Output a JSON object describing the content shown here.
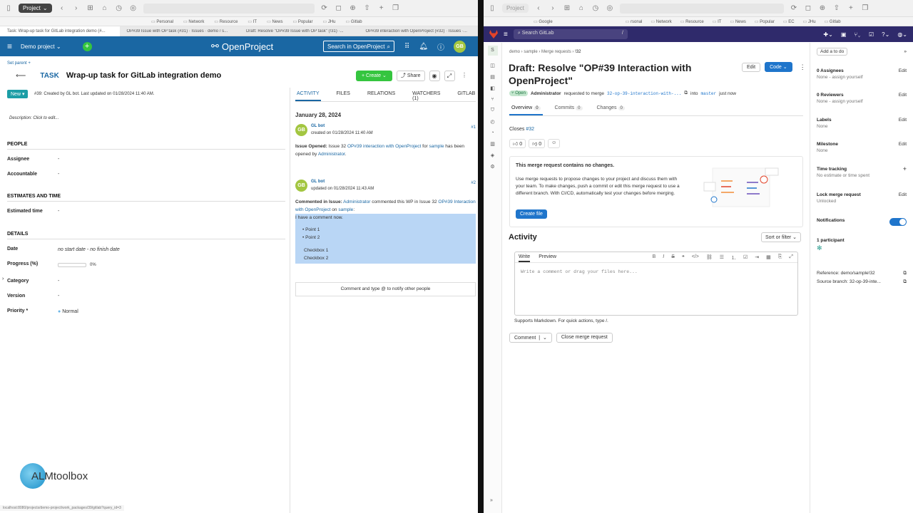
{
  "left": {
    "chrome": {
      "project_chip": "Project"
    },
    "bookmarks": [
      "Personal",
      "Network",
      "Resource",
      "IT",
      "News",
      "Popular",
      "JHu",
      "Gitlab"
    ],
    "tabs": [
      "Task: Wrap-up task for GitLab integration demo (#...",
      "OP#39 Issue with OP task (#31) · Issues · demo / s...",
      "Draft: Resolve \"OP#39 Issue with OP task\" (!31) ·...",
      "OP#39 interaction with OpenProject (#32) · Issues ·..."
    ],
    "header": {
      "project": "Demo project",
      "logo": "OpenProject",
      "search": "Search in OpenProject",
      "avatar": "GB"
    },
    "wp": {
      "set_parent": "Set parent +",
      "type": "TASK",
      "title": "Wrap-up task for GitLab integration demo",
      "create": "+ Create",
      "share": "Share",
      "status": "New",
      "created": "#39: Created by GL bot. Last updated on 01/28/2024 11:40 AM.",
      "description": "Description: Click to edit..."
    },
    "sections": {
      "people": "PEOPLE",
      "estimates": "ESTIMATES AND TIME",
      "details": "DETAILS"
    },
    "attrs": {
      "assignee": {
        "label": "Assignee",
        "value": "-"
      },
      "accountable": {
        "label": "Accountable",
        "value": "-"
      },
      "estimated": {
        "label": "Estimated time",
        "value": "-"
      },
      "date": {
        "label": "Date",
        "value": "no start date - no finish date"
      },
      "progress": {
        "label": "Progress (%)",
        "value": "0%"
      },
      "category": {
        "label": "Category",
        "value": "-"
      },
      "version": {
        "label": "Version",
        "value": "-"
      },
      "priority": {
        "label": "Priority *",
        "value": "Normal"
      }
    },
    "activity_tabs": [
      "ACTIVITY",
      "FILES",
      "RELATIONS",
      "WATCHERS (1)",
      "GITLAB"
    ],
    "activity": {
      "date": "January 28, 2024",
      "e1": {
        "name": "GL bot",
        "meta": "created on 01/28/2024 11:40 AM",
        "num": "#1",
        "b1": "Issue Opened:",
        "b2": " Issue 32 ",
        "b3": "OP#39 interaction with OpenProject",
        "b4": " for ",
        "b5": "sample",
        "b6": " has been opened by ",
        "b7": "Administrator",
        "b8": "."
      },
      "e2": {
        "name": "GL bot",
        "meta": "updated on 01/28/2024 11:43 AM",
        "num": "#2",
        "b1": "Commented in Issue:",
        "b2": " Administrator",
        "b3": " commented this WP in Issue 32 ",
        "b4": "OP#39 Interaction with OpenProject",
        "b5": " on ",
        "b6": "sample",
        "b7": ":",
        "q": "I have a comment now.",
        "p1": "Point 1",
        "p2": "Point 2",
        "c1": "Checkbox 1",
        "c2": "Checkbox 2"
      },
      "comment_placeholder": "Comment and type @ to notify other people"
    },
    "alm": "ALMtoolbox",
    "statusbar": "localhost:8080/projects/demo-project/work_packages/39/gitlab?query_id=3"
  },
  "right": {
    "chrome": {
      "project_chip": "Project"
    },
    "bookmarks": [
      "Google",
      "rsonal",
      "Network",
      "Resource",
      "IT",
      "News",
      "Popular",
      "EC",
      "JHu",
      "Gitlab"
    ],
    "search": "Search GitLab",
    "search_key": "/",
    "crumb": [
      "demo",
      "sample",
      "Merge requests",
      "!32"
    ],
    "title": "Draft: Resolve \"OP#39 Interaction with OpenProject\"",
    "edit": "Edit",
    "code": "Code",
    "status": "Open",
    "author": "Administrator",
    "requested": "requested to merge",
    "branch": "32-op-39-interaction-with-...",
    "into": "into",
    "target": "master",
    "when": "just now",
    "tabs": [
      {
        "label": "Overview",
        "count": "0"
      },
      {
        "label": "Commits",
        "count": "0"
      },
      {
        "label": "Changes",
        "count": "0"
      }
    ],
    "closes_label": "Closes",
    "closes_ref": "#32",
    "thumbsup": "0",
    "thumbsdown": "0",
    "nochanges": {
      "title": "This merge request contains no changes.",
      "body": "Use merge requests to propose changes to your project and discuss them with your team. To make changes, push a commit or edit this merge request to use a different branch. With CI/CD, automatically test your changes before merging.",
      "button": "Create file"
    },
    "activity": "Activity",
    "sort": "Sort or filter",
    "editor": {
      "write": "Write",
      "preview": "Preview",
      "placeholder": "Write a comment or drag your files here..."
    },
    "supports": "Supports Markdown. For quick actions, type /.",
    "comment": "Comment",
    "close_mr": "Close merge request",
    "sidebar": {
      "todo": "Add a to do",
      "assignees": {
        "h": "0 Assignees",
        "s": "None - assign yourself"
      },
      "reviewers": {
        "h": "0 Reviewers",
        "s": "None - assign yourself"
      },
      "labels": {
        "h": "Labels",
        "s": "None"
      },
      "milestone": {
        "h": "Milestone",
        "s": "None"
      },
      "time": {
        "h": "Time tracking",
        "s": "No estimate or time spent"
      },
      "lock": {
        "h": "Lock merge request",
        "s": "Unlocked"
      },
      "notifications": "Notifications",
      "participants": "1 participant",
      "reference": "Reference: demo/sample!32",
      "source": "Source branch: 32-op-39-inte...",
      "edit": "Edit"
    }
  }
}
